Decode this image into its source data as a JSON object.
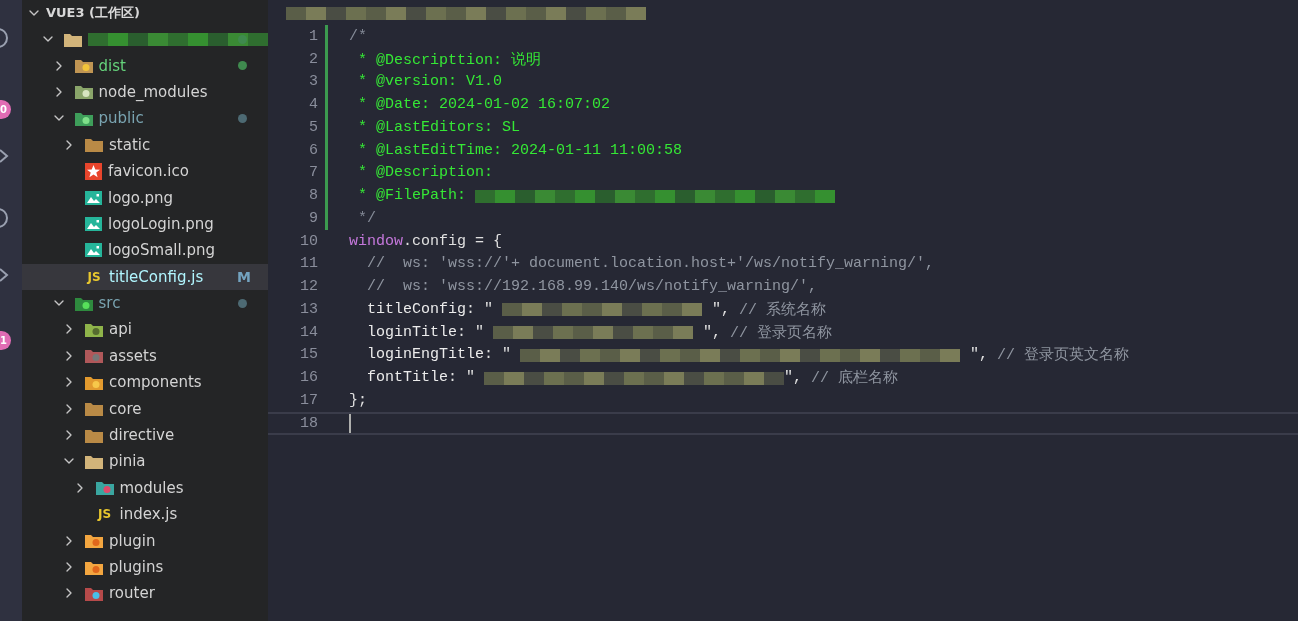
{
  "activity_bar": {
    "badges": [
      "0",
      "1"
    ]
  },
  "explorer": {
    "title": "VUE3 (工作区)",
    "tree": [
      {
        "kind": "open-folder",
        "expanded": true,
        "color": "#3f8a4e",
        "children": [
          {
            "kind": "dist-folder",
            "name": "dist",
            "expanded": false,
            "color": "#3f8a4e"
          },
          {
            "kind": "node-folder",
            "name": "node_modules",
            "expanded": false
          },
          {
            "kind": "public-folder",
            "name": "public",
            "expanded": true,
            "color": "#4d6a73",
            "children": [
              {
                "kind": "folder",
                "name": "static",
                "expanded": false
              },
              {
                "kind": "favicon-file",
                "name": "favicon.ico",
                "selected": false
              },
              {
                "kind": "image-file",
                "name": "logo.png",
                "selected": false
              },
              {
                "kind": "image-file",
                "name": "logoLogin.png",
                "selected": false
              },
              {
                "kind": "image-file",
                "name": "logoSmall.png",
                "selected": false
              },
              {
                "kind": "js-file",
                "glyph": "JS",
                "name": "titleConfig.js",
                "selected": true,
                "color": "#73a3c0",
                "badge": "M"
              }
            ]
          },
          {
            "kind": "src-folder",
            "name": "src",
            "expanded": true,
            "color": "#4d6a73",
            "children": [
              {
                "kind": "api-folder",
                "name": "api",
                "expanded": false
              },
              {
                "kind": "assets-folder",
                "name": "assets",
                "expanded": false
              },
              {
                "kind": "components-folder",
                "name": "components",
                "expanded": false
              },
              {
                "kind": "folder",
                "name": "core",
                "expanded": false
              },
              {
                "kind": "folder",
                "name": "directive",
                "expanded": false
              },
              {
                "kind": "open-folder",
                "name": "pinia",
                "expanded": true,
                "children": [
                  {
                    "kind": "modules-folder",
                    "name": "modules",
                    "expanded": false
                  },
                  {
                    "kind": "js-file",
                    "glyph": "JS",
                    "name": "index.js",
                    "selected": false
                  }
                ]
              },
              {
                "kind": "plugin-folder",
                "name": "plugin",
                "expanded": false
              },
              {
                "kind": "plugin-folder",
                "name": "plugins",
                "expanded": false
              },
              {
                "kind": "router-folder",
                "name": "router",
                "expanded": false
              }
            ]
          }
        ]
      }
    ]
  },
  "editor": {
    "lines": [
      {
        "number": "1",
        "changed": true,
        "tokens": [
          {
            "kind": "punct-comment",
            "text": "/*"
          }
        ]
      },
      {
        "number": "2",
        "changed": true,
        "tokens": [
          {
            "kind": "doc",
            "text": " * @Descripttion: 说明"
          }
        ]
      },
      {
        "number": "3",
        "changed": true,
        "tokens": [
          {
            "kind": "doc",
            "text": " * @version: V1.0"
          }
        ]
      },
      {
        "number": "4",
        "changed": true,
        "tokens": [
          {
            "kind": "doc",
            "text": " * @Date: 2024-01-02 16:07:02"
          }
        ]
      },
      {
        "number": "5",
        "changed": true,
        "tokens": [
          {
            "kind": "doc",
            "text": " * @LastEditors: SL"
          }
        ]
      },
      {
        "number": "6",
        "changed": true,
        "tokens": [
          {
            "kind": "doc",
            "text": " * @LastEditTime: 2024-01-11 11:00:58"
          }
        ]
      },
      {
        "number": "7",
        "changed": true,
        "tokens": [
          {
            "kind": "doc",
            "text": " * @Description:"
          }
        ]
      },
      {
        "number": "8",
        "changed": true,
        "tokens": [
          {
            "kind": "doc",
            "text": " * @FilePath:"
          },
          {
            "kind": "redacted"
          }
        ]
      },
      {
        "number": "9",
        "changed": true,
        "tokens": [
          {
            "kind": "punct-comment",
            "text": " */"
          }
        ]
      },
      {
        "number": "10",
        "changed": false,
        "tokens": [
          {
            "kind": "keyword",
            "text": "window"
          },
          {
            "kind": "plain",
            "text": ".config = {"
          }
        ]
      },
      {
        "number": "11",
        "changed": false,
        "tokens": [
          {
            "kind": "comment",
            "text": "  //  ws: 'wss://'+ document.location.host+'/ws/notify_warning/',"
          }
        ]
      },
      {
        "number": "12",
        "changed": false,
        "tokens": [
          {
            "kind": "comment",
            "text": "  //  ws: 'wss://192.168.99.140/ws/notify_warning/',"
          }
        ]
      },
      {
        "number": "13",
        "changed": false,
        "tokens": [
          {
            "kind": "property",
            "text": "  titleConfig"
          },
          {
            "kind": "plain",
            "text": ": \""
          },
          {
            "kind": "redacted"
          },
          {
            "kind": "plain",
            "text": "\","
          },
          {
            "kind": "comment",
            "text": "// 系统名称"
          }
        ]
      },
      {
        "number": "14",
        "changed": false,
        "tokens": [
          {
            "kind": "property",
            "text": "  loginTitle"
          },
          {
            "kind": "plain",
            "text": ": \""
          },
          {
            "kind": "redacted"
          },
          {
            "kind": "plain",
            "text": "\","
          },
          {
            "kind": "comment",
            "text": "// 登录页名称"
          }
        ]
      },
      {
        "number": "15",
        "changed": false,
        "tokens": [
          {
            "kind": "property",
            "text": "  loginEngTitle"
          },
          {
            "kind": "plain",
            "text": ": \""
          },
          {
            "kind": "redacted"
          },
          {
            "kind": "plain",
            "text": "\","
          },
          {
            "kind": "comment",
            "text": "// 登录页英文名称"
          }
        ]
      },
      {
        "number": "16",
        "changed": false,
        "tokens": [
          {
            "kind": "property",
            "text": "  fontTitle"
          },
          {
            "kind": "plain",
            "text": ": \""
          },
          {
            "kind": "redacted"
          },
          {
            "kind": "plain",
            "text": "\","
          },
          {
            "kind": "comment",
            "text": "// 底栏名称"
          }
        ]
      },
      {
        "number": "17",
        "changed": false,
        "tokens": [
          {
            "kind": "plain",
            "text": "};"
          }
        ]
      },
      {
        "number": "18",
        "changed": false,
        "current": true
      }
    ]
  }
}
